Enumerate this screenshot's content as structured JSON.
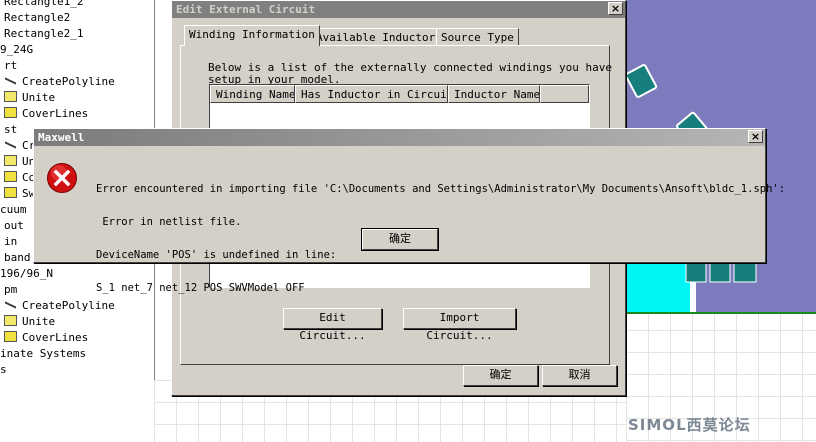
{
  "tree": {
    "items": [
      {
        "label": "Rectangle1_2",
        "icon": "none"
      },
      {
        "label": "Rectangle2",
        "icon": "none"
      },
      {
        "label": "Rectangle2_1",
        "icon": "none"
      },
      {
        "label": "9_24G",
        "icon": "none"
      },
      {
        "label": "rt",
        "icon": "none"
      },
      {
        "label": "CreatePolyline",
        "icon": "polyline-icon"
      },
      {
        "label": "Unite",
        "icon": "unite-icon"
      },
      {
        "label": "CoverLines",
        "icon": "coverlines-icon"
      },
      {
        "label": "st",
        "icon": "none"
      },
      {
        "label": "Cr",
        "icon": "polyline-icon"
      },
      {
        "label": "Un",
        "icon": "unite-icon"
      },
      {
        "label": "Co",
        "icon": "coverlines-icon"
      },
      {
        "label": "Sw",
        "icon": "coverlines-icon"
      },
      {
        "label": "cuum",
        "icon": "none"
      },
      {
        "label": "out",
        "icon": "none"
      },
      {
        "label": "in",
        "icon": "none"
      },
      {
        "label": "band",
        "icon": "none"
      },
      {
        "label": "196/96_N",
        "icon": "none"
      },
      {
        "label": "pm",
        "icon": "none"
      },
      {
        "label": "CreatePolyline",
        "icon": "polyline-icon"
      },
      {
        "label": "Unite",
        "icon": "unite-icon"
      },
      {
        "label": "CoverLines",
        "icon": "coverlines-icon"
      },
      {
        "label": "inate Systems",
        "icon": "none"
      },
      {
        "label": "s",
        "icon": "none"
      }
    ]
  },
  "edit_dialog": {
    "title": "Edit External Circuit",
    "tabs": [
      "Winding Information",
      "Available Inductors",
      "Source Type"
    ],
    "selected_tab": 0,
    "description_line1": "Below is a list of the externally connected windings you have",
    "description_line2": "setup in your model.",
    "columns": [
      "Winding Name",
      "Has Inductor in Circuit",
      "Inductor Name"
    ],
    "edit_circuit_label": "Edit Circuit...",
    "import_circuit_label": "Import Circuit...",
    "ok_label": "确定",
    "cancel_label": "取消"
  },
  "message_box": {
    "title": "Maxwell",
    "line1": "Error encountered in importing file 'C:\\Documents and Settings\\Administrator\\My Documents\\Ansoft\\bldc_1.sph':",
    "line2": " Error in netlist file.",
    "line3": "DeviceName 'POS' is undefined in line:",
    "line4": "S_1 net_7 net_12 POS SWVModel OFF",
    "ok_label": "确定",
    "icon": "error-icon"
  },
  "watermark": "SIMOL西莫论坛",
  "colors": {
    "motor_body": "#7b7bbd",
    "magnet": "#1aa3a3",
    "airgap": "#00ffff",
    "title_inactive": "#808080",
    "error_red": "#d01010"
  }
}
